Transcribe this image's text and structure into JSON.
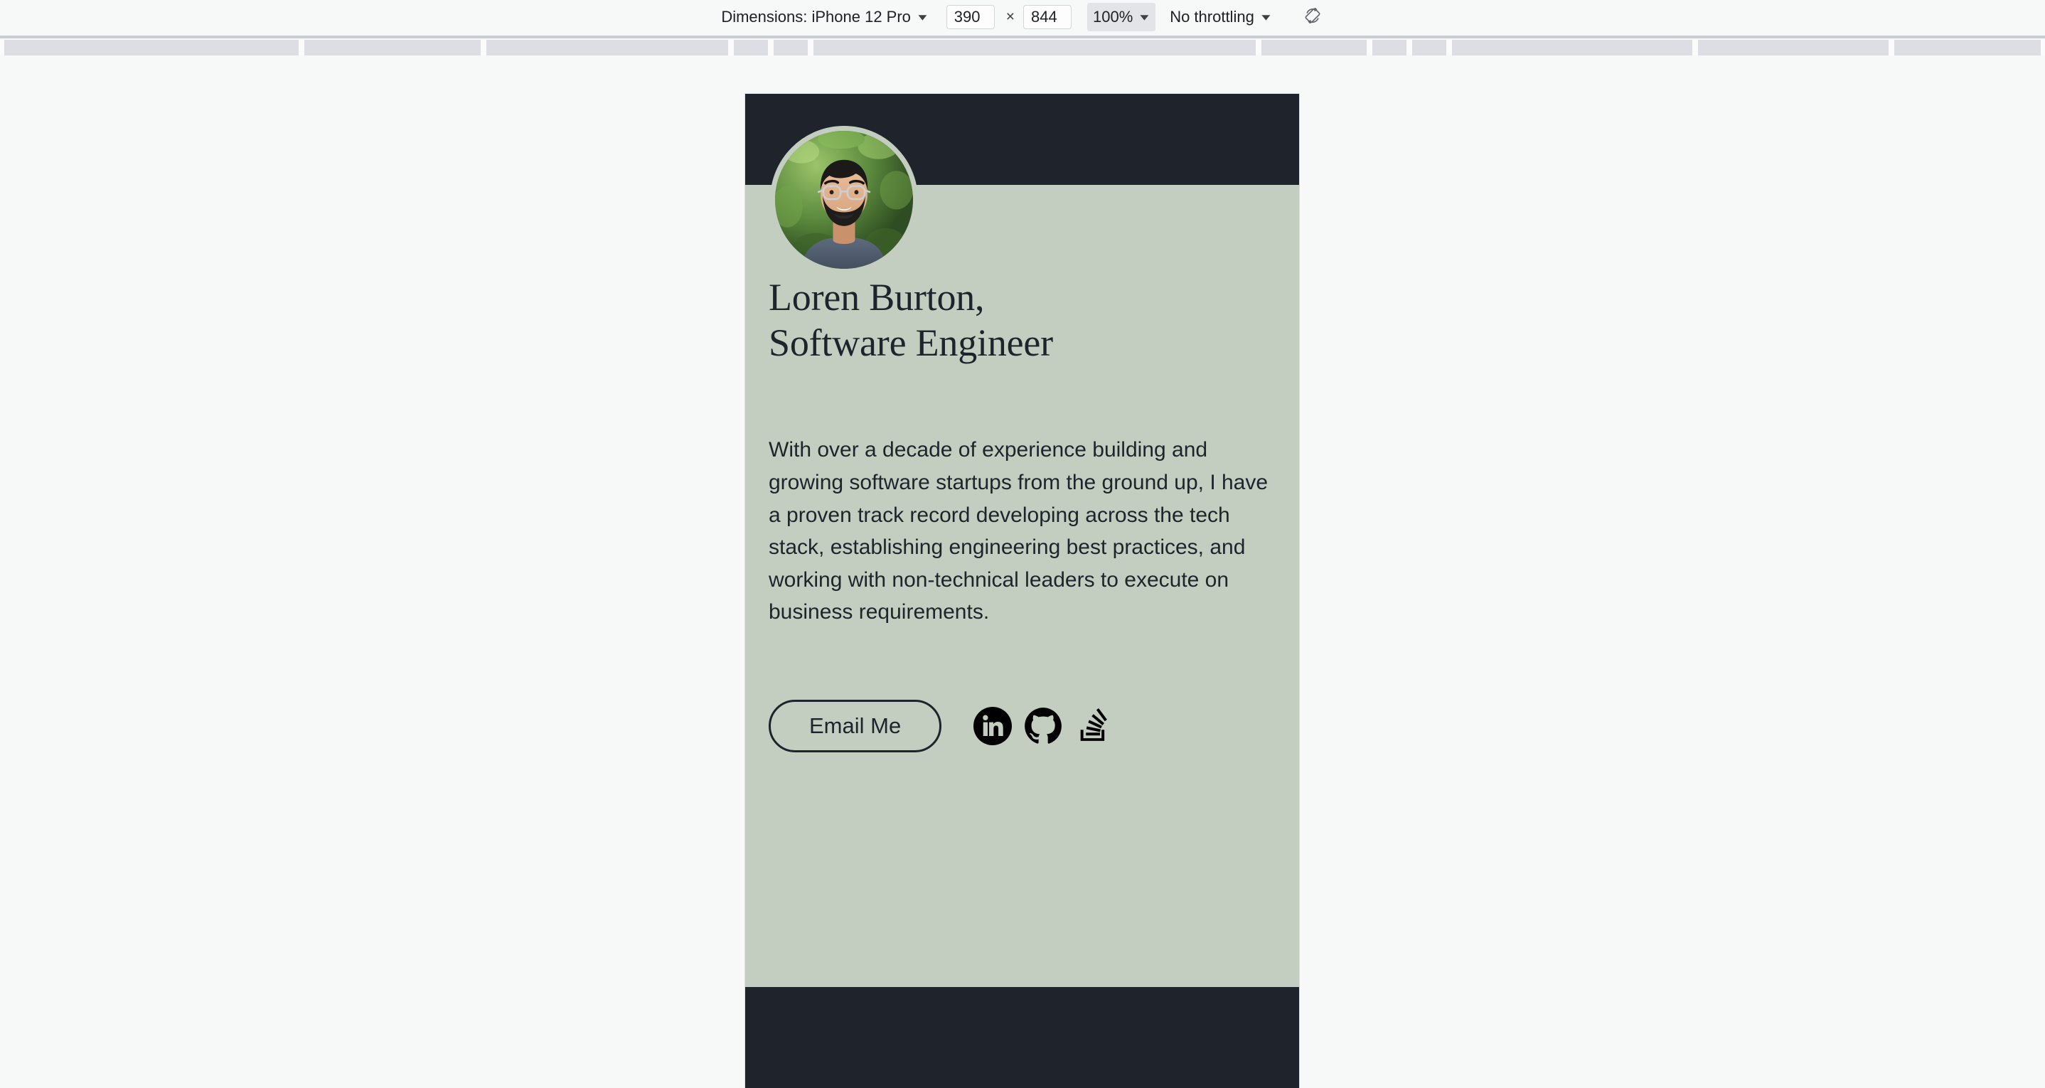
{
  "devtools_toolbar": {
    "dimensions_label": "Dimensions: iPhone 12 Pro",
    "width_value": "390",
    "height_value": "844",
    "width_placeholder": "width",
    "height_placeholder": "height",
    "multiply_symbol": "×",
    "zoom_value": "100%",
    "throttling_value": "No throttling",
    "caret_glyph": "▼",
    "rotate_icon_name": "rotate-device-icon"
  },
  "page": {
    "title_line1": "Loren Burton,",
    "title_line2": "Software Engineer",
    "bio": "With over a decade of experience building and growing software startups from the ground up, I have a proven track record developing across the tech stack, establishing engineering best practices, and working with non-technical leaders to execute on business requirements.",
    "email_button_label": "Email Me",
    "avatar_alt": "Portrait of Loren Burton",
    "socials": [
      {
        "name": "linkedin",
        "icon": "linkedin-icon"
      },
      {
        "name": "github",
        "icon": "github-icon"
      },
      {
        "name": "stackoverflow",
        "icon": "stackoverflow-icon"
      }
    ]
  },
  "colors": {
    "dark": "#1f242c",
    "sage": "#c3cec1",
    "page_background": "#f7f8f8",
    "toolbar_segment": "#dcdee3",
    "icon": "#000000"
  }
}
